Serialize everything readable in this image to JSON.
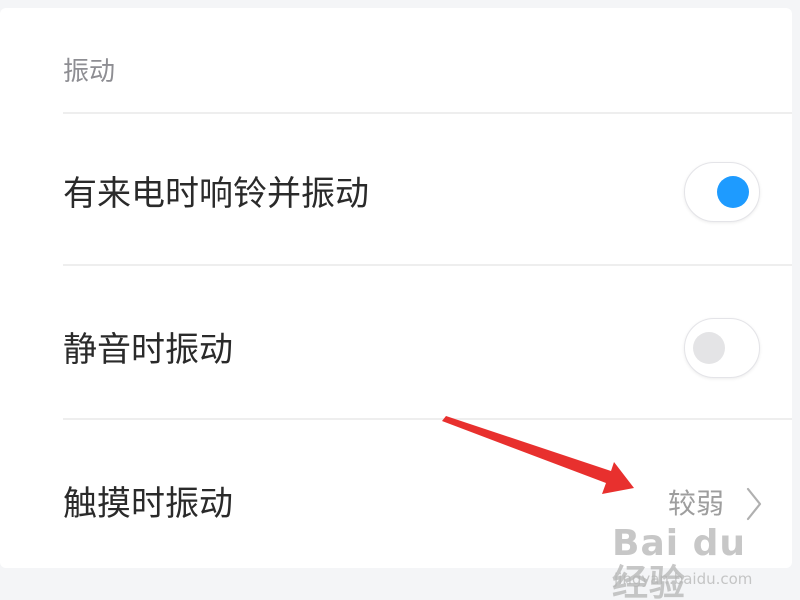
{
  "section": {
    "title": "振动"
  },
  "rows": [
    {
      "label": "有来电时响铃并振动",
      "toggle_state": "on"
    },
    {
      "label": "静音时振动",
      "toggle_state": "off"
    },
    {
      "label": "触摸时振动",
      "value": "较弱"
    }
  ],
  "colors": {
    "toggle_on": "#1e9bff",
    "toggle_off_knob": "#e4e4e6",
    "annotation_arrow": "#e8302e"
  },
  "icons": {
    "chevron": "chevron-right-icon",
    "arrow": "red-arrow-annotation"
  },
  "watermark": {
    "logo": "Bai du 经验",
    "url": "jingyan.baidu.com"
  }
}
